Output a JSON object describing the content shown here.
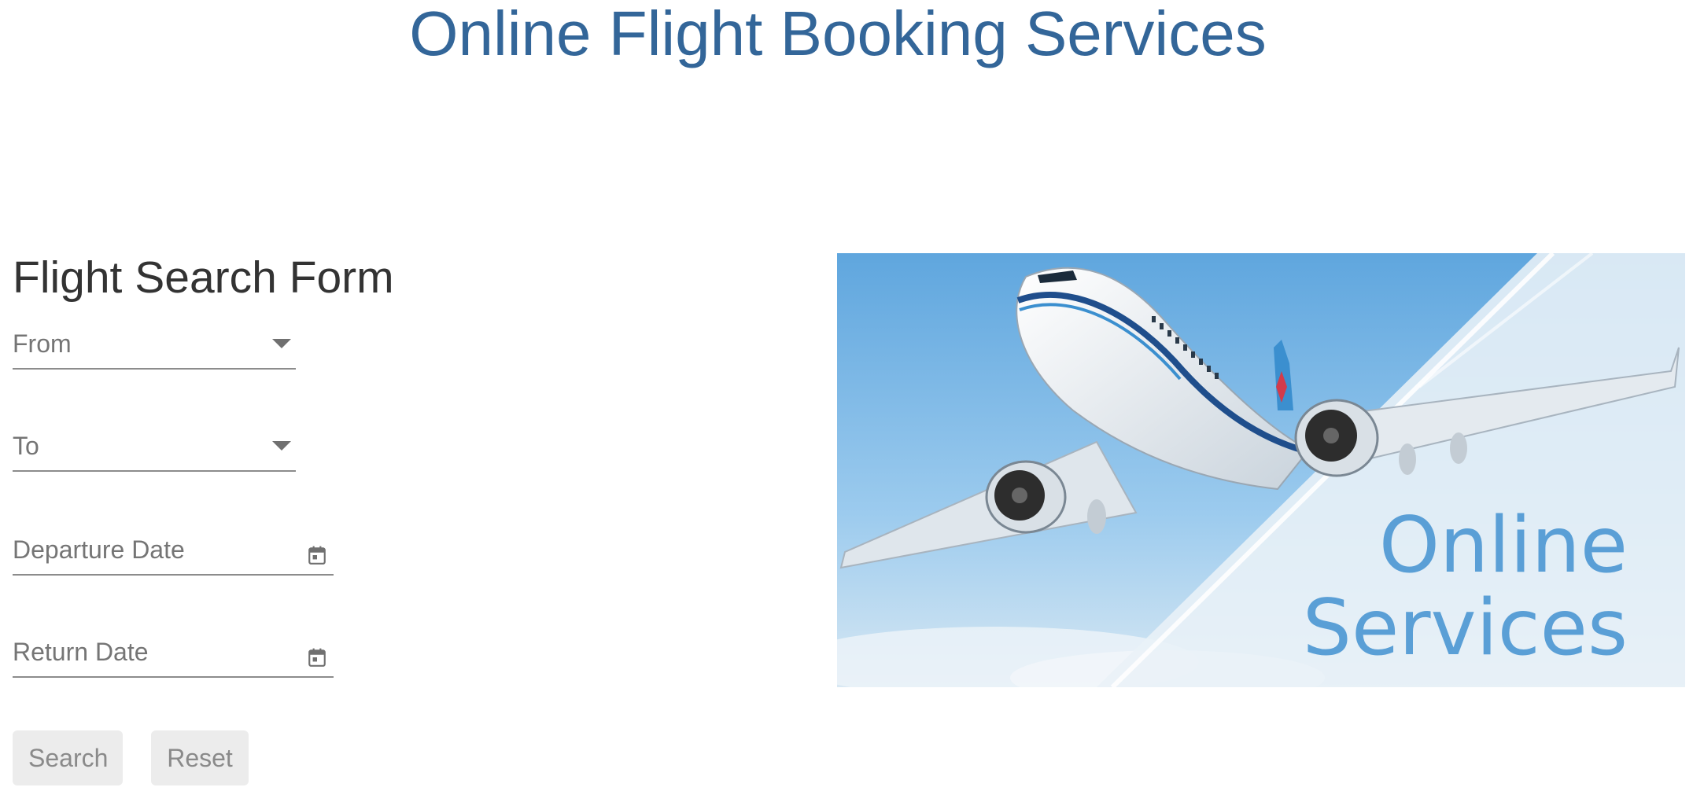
{
  "page": {
    "title": "Online Flight Booking Services"
  },
  "form": {
    "heading": "Flight Search Form",
    "from_label": "From",
    "to_label": "To",
    "departure_label": "Departure Date",
    "return_label": "Return Date",
    "search_label": "Search",
    "reset_label": "Reset"
  },
  "banner": {
    "line1": "Online",
    "line2": "Services"
  },
  "colors": {
    "title": "#336699",
    "banner_text": "#5a9fd6",
    "button_bg": "#ececec"
  },
  "icons": {
    "dropdown": "chevron-down-icon",
    "date": "calendar-icon"
  }
}
